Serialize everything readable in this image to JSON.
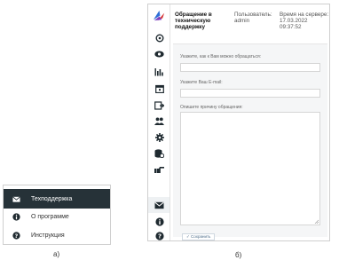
{
  "panel_a": {
    "caption": "а)",
    "items": [
      {
        "label": "Техподдержка",
        "icon": "envelope-icon",
        "active": true
      },
      {
        "label": "О программе",
        "icon": "info-icon",
        "active": false
      },
      {
        "label": "Инструкция",
        "icon": "question-icon",
        "active": false
      }
    ]
  },
  "panel_b": {
    "caption": "б)",
    "header": {
      "title": "Обращение в техническую поддержку",
      "user_label": "Пользователь:",
      "user_value": "admin",
      "time_label": "Время на сервере:",
      "time_date": "17.03.2022",
      "time_clock": "09:37:52"
    },
    "form": {
      "contact_label": "Укажите, как к Вам можно обращаться:",
      "contact_value": "",
      "email_label": "Укажите Ваш E-mail:",
      "email_value": "",
      "reason_label": "Опишите причину обращения:",
      "reason_value": "",
      "save_label": "✓ Сохранить"
    },
    "sidebar_icons": [
      "logo-icon",
      "location-icon",
      "eye-icon",
      "bar-chart-icon",
      "calendar-icon",
      "export-icon",
      "users-icon",
      "gear-icon",
      "database-icon",
      "hand-point-icon",
      "envelope-icon",
      "info-icon",
      "question-icon"
    ]
  },
  "colors": {
    "menu_active_bg": "#263238",
    "icon_dark": "#1f2a30",
    "accent_blue": "#2e6fd6",
    "accent_red": "#d63a3a",
    "accent_purple": "#7a3fc0"
  }
}
